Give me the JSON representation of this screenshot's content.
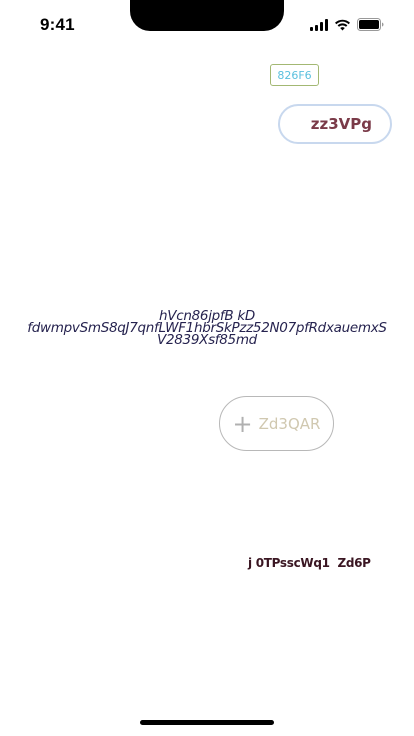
{
  "status_bar": {
    "time": "9:41"
  },
  "tag": {
    "label": "826F6"
  },
  "pill_button": {
    "label": "zz3VPg"
  },
  "center_text": {
    "line1": "hVcn86jpfB kD",
    "line2": "fdwmpvSmS8qJ7qnfLWF1hbrSkPzz52N07pfRdxauemxS",
    "line3": "V2839Xsf85md"
  },
  "add_button": {
    "label": "Zd3QAR",
    "icon": "plus-icon"
  },
  "footer": {
    "text": "j 0TPsscWq1  Zd6P"
  },
  "colors": {
    "tag_border": "#a3b873",
    "tag_text": "#5bc0de",
    "pill_border": "#c8d8ee",
    "pill_text": "#7a3a48",
    "center_text": "#26234f",
    "footer_text": "#3a1622"
  }
}
